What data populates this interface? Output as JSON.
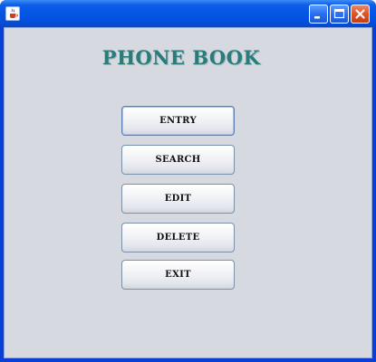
{
  "window": {
    "title": "",
    "icon": "java-cup-icon",
    "controls": [
      "minimize-icon",
      "maximize-icon",
      "close-icon"
    ],
    "colors": {
      "titlebar": "#0456e4",
      "client_background": "#d6d9df",
      "heading_color": "#2a7c7c",
      "close_button": "#d9562a"
    }
  },
  "main": {
    "heading": "PHONE BOOK",
    "buttons": {
      "entry": "ENTRY",
      "search": "SEARCH",
      "edit": "EDIT",
      "delete": "DELETE",
      "exit": "EXIT"
    }
  }
}
